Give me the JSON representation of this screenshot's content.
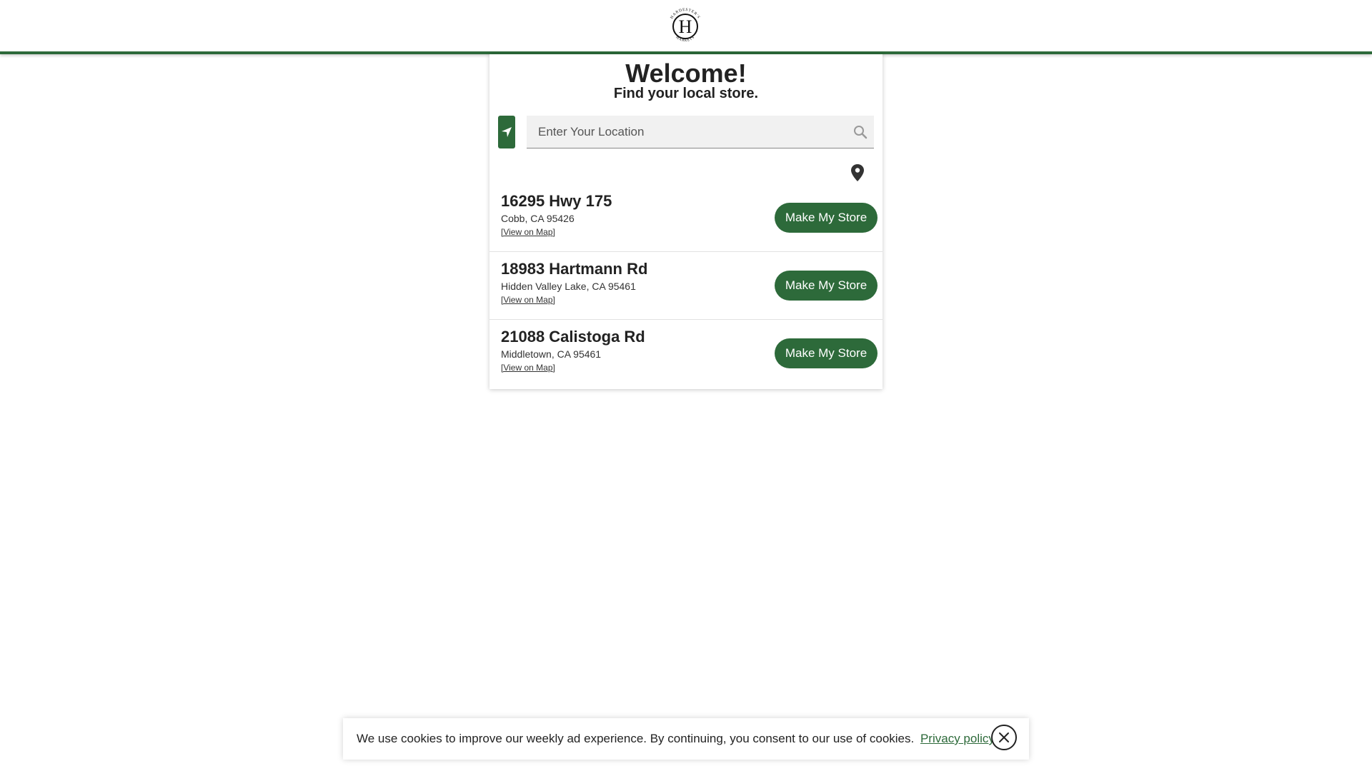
{
  "header": {
    "logo_letter": "H",
    "logo_top_text": "HARDESTER'S",
    "logo_bottom_text": "MARKETS"
  },
  "panel": {
    "title": "Welcome!",
    "subtitle": "Find your local store."
  },
  "search": {
    "placeholder": "Enter Your Location",
    "value": ""
  },
  "icons": {
    "geolocate": "navigation-arrow-icon",
    "search": "search-icon",
    "map": "map-pin-icon",
    "close": "close-icon"
  },
  "stores": [
    {
      "name": "16295 Hwy 175",
      "city": "Cobb, CA 95426",
      "map_link": "[View on Map]",
      "button": "Make My Store"
    },
    {
      "name": "18983 Hartmann Rd",
      "city": "Hidden Valley Lake, CA 95461",
      "map_link": "[View on Map]",
      "button": "Make My Store"
    },
    {
      "name": "21088 Calistoga Rd",
      "city": "Middletown, CA 95461",
      "map_link": "[View on Map]",
      "button": "Make My Store"
    }
  ],
  "cookie": {
    "text": "We use cookies to improve our weekly ad experience. By continuing, you consent to our use of cookies.",
    "link": "Privacy policy"
  },
  "colors": {
    "brand_green": "#2d6a3a",
    "text": "#222222",
    "search_bg": "#f1f1f1"
  }
}
